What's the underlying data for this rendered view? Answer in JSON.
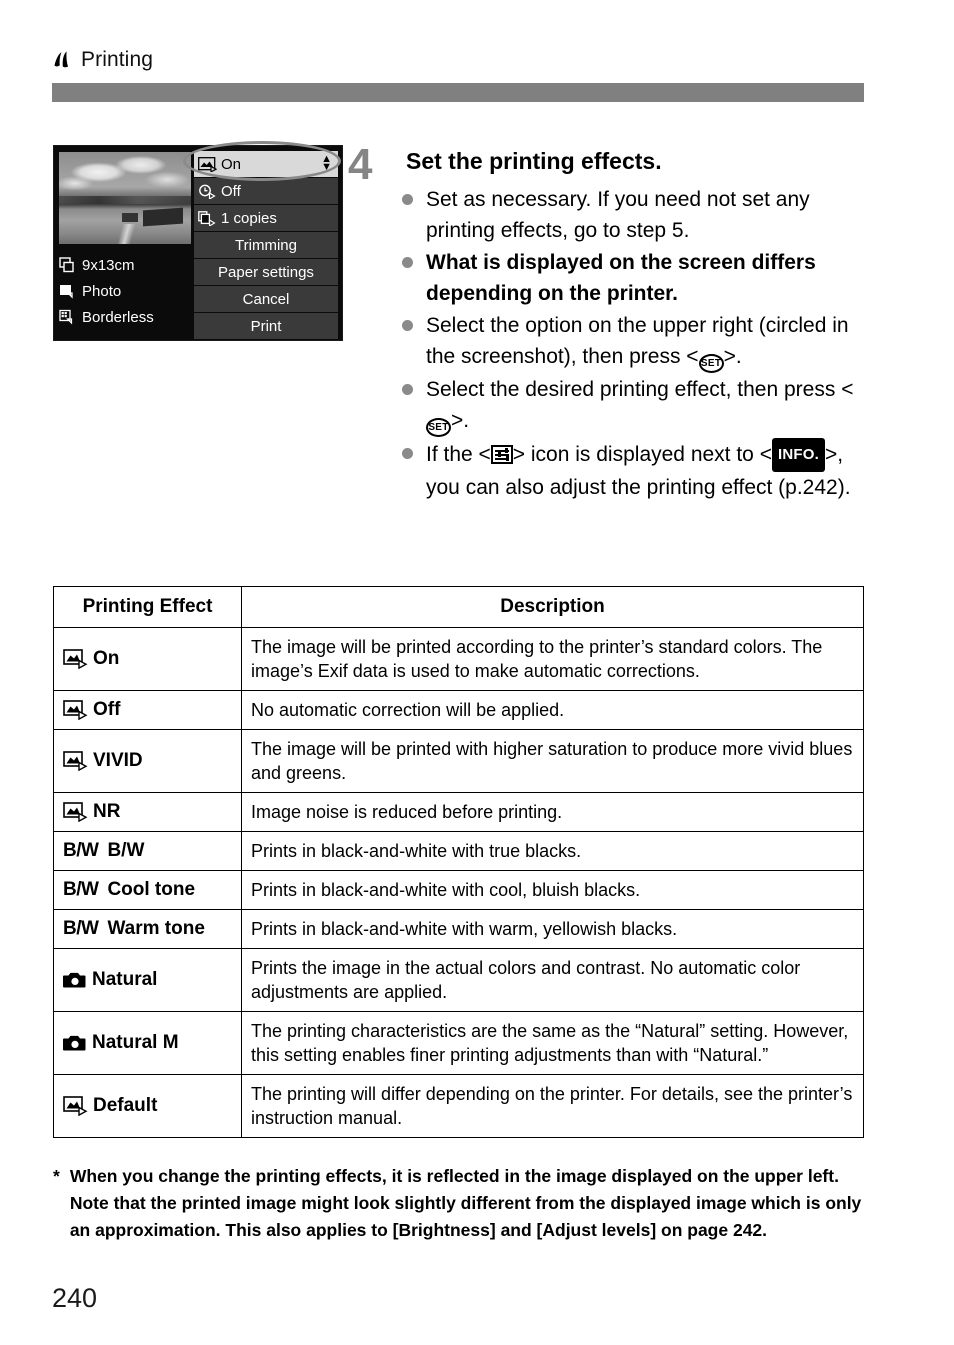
{
  "header": {
    "icon": "printer-flag-icon",
    "title": "Printing"
  },
  "lcd": {
    "icons": {
      "photo_effect": "photo-effect-icon",
      "date": "clock-date-icon",
      "copies": "copies-stack-icon",
      "paper_size": "paper-size-icon",
      "paper_type": "paper-type-icon",
      "layout": "layout-borderless-icon"
    },
    "left_items": [
      {
        "icon": "paper-size-icon",
        "label": "9x13cm"
      },
      {
        "icon": "paper-type-icon",
        "label": "Photo"
      },
      {
        "icon": "layout-borderless-icon",
        "label": "Borderless"
      }
    ],
    "right_items": [
      {
        "icon": "photo-effect-icon",
        "label": "On",
        "selected": true,
        "has_arrows": true
      },
      {
        "icon": "clock-date-icon",
        "label": "Off",
        "selected": false,
        "has_arrows": false
      },
      {
        "icon": "copies-stack-icon",
        "label": "1   copies",
        "selected": false,
        "has_arrows": false
      },
      {
        "icon": "",
        "label": "Trimming",
        "selected": false,
        "has_arrows": false
      },
      {
        "icon": "",
        "label": "Paper settings",
        "selected": false,
        "has_arrows": false
      },
      {
        "icon": "",
        "label": "Cancel",
        "selected": false,
        "has_arrows": false
      },
      {
        "icon": "",
        "label": "Print",
        "selected": false,
        "has_arrows": false
      }
    ]
  },
  "step": {
    "number": "4",
    "title": "Set the printing effects.",
    "bullets": [
      {
        "bold": false,
        "segments": [
          {
            "type": "text",
            "value": "Set as necessary. If you need not set any printing effects, go to step 5."
          }
        ]
      },
      {
        "bold": true,
        "segments": [
          {
            "type": "text",
            "value": "What is displayed on the screen differs depending on the printer."
          }
        ]
      },
      {
        "bold": false,
        "segments": [
          {
            "type": "text",
            "value": "Select the option on the upper right (circled in the screenshot), then press <"
          },
          {
            "type": "icon",
            "value": "set-button-icon",
            "label": "SET"
          },
          {
            "type": "text",
            "value": ">."
          }
        ]
      },
      {
        "bold": false,
        "segments": [
          {
            "type": "text",
            "value": "Select the desired printing effect, then press <"
          },
          {
            "type": "icon",
            "value": "set-button-icon",
            "label": "SET"
          },
          {
            "type": "text",
            "value": ">."
          }
        ]
      },
      {
        "bold": false,
        "segments": [
          {
            "type": "text",
            "value": "If the <"
          },
          {
            "type": "icon",
            "value": "adjust-levels-icon",
            "label": ""
          },
          {
            "type": "text",
            "value": "> icon is displayed next to <"
          },
          {
            "type": "icon",
            "value": "info-button-icon",
            "label": "INFO."
          },
          {
            "type": "text",
            "value": ">, you can also adjust the printing effect (p.242)."
          }
        ]
      }
    ]
  },
  "table": {
    "headers": [
      "Printing Effect",
      "Description"
    ],
    "rows": [
      {
        "icon": "photo-effect-icon",
        "effect": "On",
        "description": "The image will be printed according to the printer’s standard colors. The image’s Exif data is used to make automatic corrections."
      },
      {
        "icon": "photo-effect-icon",
        "effect": "Off",
        "description": "No automatic correction will be applied."
      },
      {
        "icon": "photo-effect-icon",
        "effect": "VIVID",
        "description": "The image will be printed with higher saturation to produce more vivid blues and greens."
      },
      {
        "icon": "photo-effect-icon",
        "effect": "NR",
        "description": "Image noise is reduced before printing."
      },
      {
        "icon": "bw-mark-icon",
        "icon_text": "B/W",
        "effect": "B/W",
        "description": "Prints in black-and-white with true blacks."
      },
      {
        "icon": "bw-mark-icon",
        "icon_text": "B/W",
        "effect": "Cool tone",
        "description": "Prints in black-and-white with cool, bluish blacks."
      },
      {
        "icon": "bw-mark-icon",
        "icon_text": "B/W",
        "effect": "Warm tone",
        "description": "Prints in black-and-white with warm, yellowish blacks."
      },
      {
        "icon": "camera-icon",
        "effect": "Natural",
        "description": "Prints the image in the actual colors and contrast. No automatic color adjustments are applied."
      },
      {
        "icon": "camera-icon",
        "effect": "Natural M",
        "description": "The printing characteristics are the same as the “Natural” setting. However, this setting enables finer printing adjustments than with “Natural.”"
      },
      {
        "icon": "photo-effect-icon",
        "effect": "Default",
        "description": "The printing will differ depending on the printer. For details, see the printer’s instruction manual."
      }
    ]
  },
  "footnote": {
    "marker": "*",
    "text": "When you change the printing effects, it is reflected in the image displayed on the upper left. Note that the printed image might look slightly different from the displayed image which is only an approximation. This also applies to [Brightness] and [Adjust levels] on page 242."
  },
  "page_number": "240"
}
